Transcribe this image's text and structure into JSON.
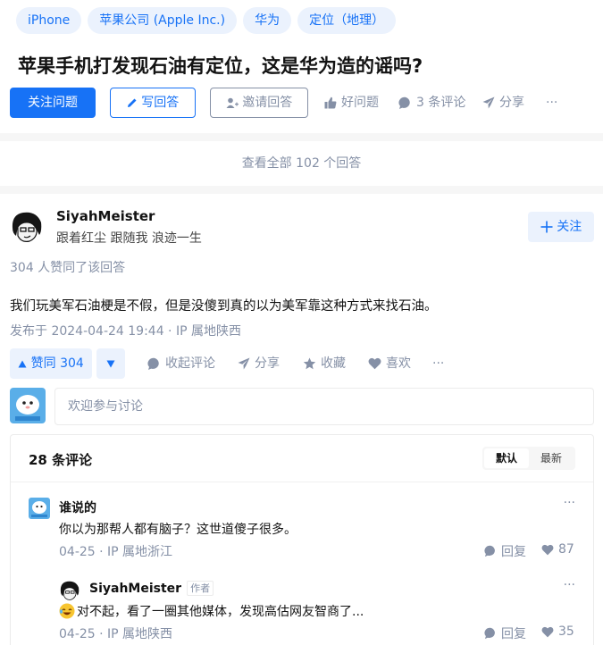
{
  "question": {
    "topics": [
      "iPhone",
      "苹果公司 (Apple Inc.)",
      "华为",
      "定位（地理）"
    ],
    "title": "苹果手机打发现石油有定位，这是华为造的谣吗?",
    "actions": {
      "follow": "关注问题",
      "write": "写回答",
      "invite": "邀请回答",
      "good_question": "好问题",
      "comments": "3 条评论",
      "share": "分享",
      "more": "···"
    }
  },
  "view_all": "查看全部 102 个回答",
  "answer": {
    "author": "SiyahMeister",
    "bio": "跟着红尘 跟随我 浪迹一生",
    "follow": "关注",
    "voters": "304 人赞同了该回答",
    "content": "我们玩美军石油梗是不假，但是没傻到真的以为美军靠这种方式来找石油。",
    "meta": "发布于 2024-04-24 19:44 · IP 属地陕西",
    "actions": {
      "upvote": "赞同 304",
      "collapse_comments": "收起评论",
      "share": "分享",
      "collect": "收藏",
      "like": "喜欢",
      "more": "···"
    }
  },
  "comment_input": {
    "placeholder": "欢迎参与讨论"
  },
  "comments": {
    "count": "28 条评论",
    "sort": {
      "default": "默认",
      "latest": "最新"
    },
    "items": [
      {
        "user": "谁说的",
        "text": "你以为那帮人都有脑子？这世道傻子很多。",
        "meta": "04-25 · IP 属地浙江",
        "reply": "回复",
        "likes": "87",
        "more": "···"
      },
      {
        "user": "SiyahMeister",
        "badge": "作者",
        "text": "对不起，看了一圈其他媒体，发现高估网友智商了...",
        "meta": "04-25 · IP 属地陕西",
        "reply": "回复",
        "likes": "35",
        "more": "···"
      }
    ]
  },
  "colors": {
    "brand": "#1772f6",
    "brand_light": "#ebf2fd",
    "muted": "#8590a6",
    "background": "#f6f6f6"
  }
}
